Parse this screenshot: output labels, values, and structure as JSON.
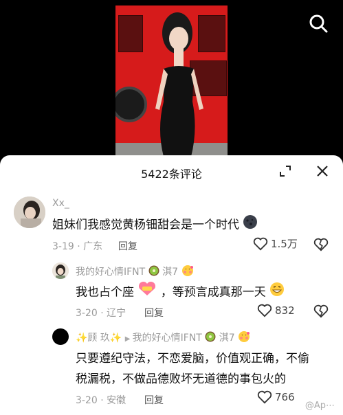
{
  "sheet": {
    "title": "5422条评论"
  },
  "comments": [
    {
      "user": "Xx_",
      "text": "姐妹们我感觉黄杨钿甜会是一个时代",
      "date": "3-19",
      "location": "广东",
      "reply": "回复",
      "likes": "1.5万"
    },
    {
      "user": "我的好心情IFNT",
      "user_suffix": "淇7",
      "text_a": "我也占个座",
      "text_b": "，等预言成真那一天",
      "date": "3-20",
      "location": "辽宁",
      "reply": "回复",
      "likes": "832"
    },
    {
      "user": "✨顾 玖✨",
      "reply_to": "我的好心情IFNT",
      "reply_to_suffix": "淇7",
      "text_line1": "只要遵纪守法，不恋爱脑，价值观正确，不偷",
      "text_line2": "税漏税，不做品德败坏无道德的事包火的",
      "date": "3-20",
      "location": "安徽",
      "reply": "回复",
      "likes": "766"
    }
  ],
  "watermark": "@Ap⋯",
  "icons": {
    "search": "search-icon",
    "collapse": "collapse-icon",
    "close": "close-icon",
    "heart": "heart-icon",
    "broken_heart": "dislike-icon"
  }
}
